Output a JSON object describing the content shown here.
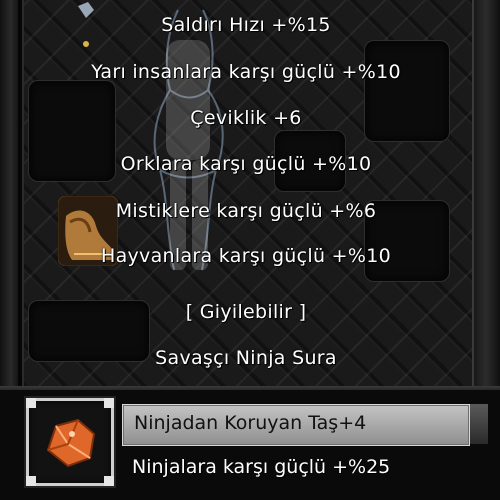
{
  "tooltip": {
    "lines": [
      "Saldırı Hızı +%15",
      "Yarı insanlara karşı güçlü +%10",
      "Çeviklik +6",
      "Orklara karşı güçlü +%10",
      "Mistiklere karşı güçlü +%6",
      "Hayvanlara karşı güçlü +%10",
      "[ Giyilebilir ]",
      "Savaşçı Ninja Sura"
    ]
  },
  "equipped_item": {
    "name": "Ninjadan Koruyan Taş+4",
    "bonus": "Ninjalara karşı güçlü +%25",
    "icon": "stone-icon"
  },
  "colors": {
    "tooltip_text": "#ffffff",
    "title_bar": "#b0b0b0",
    "item_stone": "#e0672a"
  }
}
